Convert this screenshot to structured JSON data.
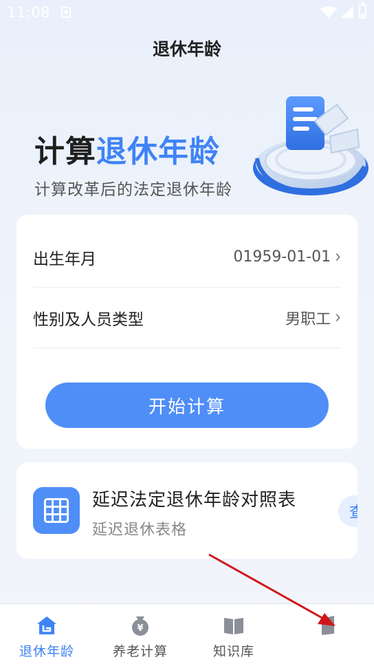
{
  "status_bar": {
    "time": "11:08"
  },
  "header": {
    "title": "退休年龄"
  },
  "hero": {
    "title_plain": "计算",
    "title_accent": "退休年龄",
    "subtitle": "计算改革后的法定退休年龄"
  },
  "form": {
    "birth": {
      "label": "出生年月",
      "value": "01959-01-01"
    },
    "gender": {
      "label": "性别及人员类型",
      "value": "男职工"
    },
    "submit_label": "开始计算"
  },
  "table_card": {
    "title": "延迟法定退休年龄对照表",
    "subtitle": "延迟退休表格",
    "view_label": "查看"
  },
  "tabbar": {
    "items": [
      {
        "label": "退休年龄",
        "icon": "home-icon",
        "active": true
      },
      {
        "label": "养老计算",
        "icon": "money-bag-icon",
        "active": false
      },
      {
        "label": "知识库",
        "icon": "book-icon",
        "active": false
      },
      {
        "label": "",
        "icon": "profile-icon",
        "active": false
      }
    ]
  },
  "colors": {
    "accent": "#3f83f5",
    "button": "#4f8ef7",
    "annotation_arrow": "#d0161b"
  }
}
